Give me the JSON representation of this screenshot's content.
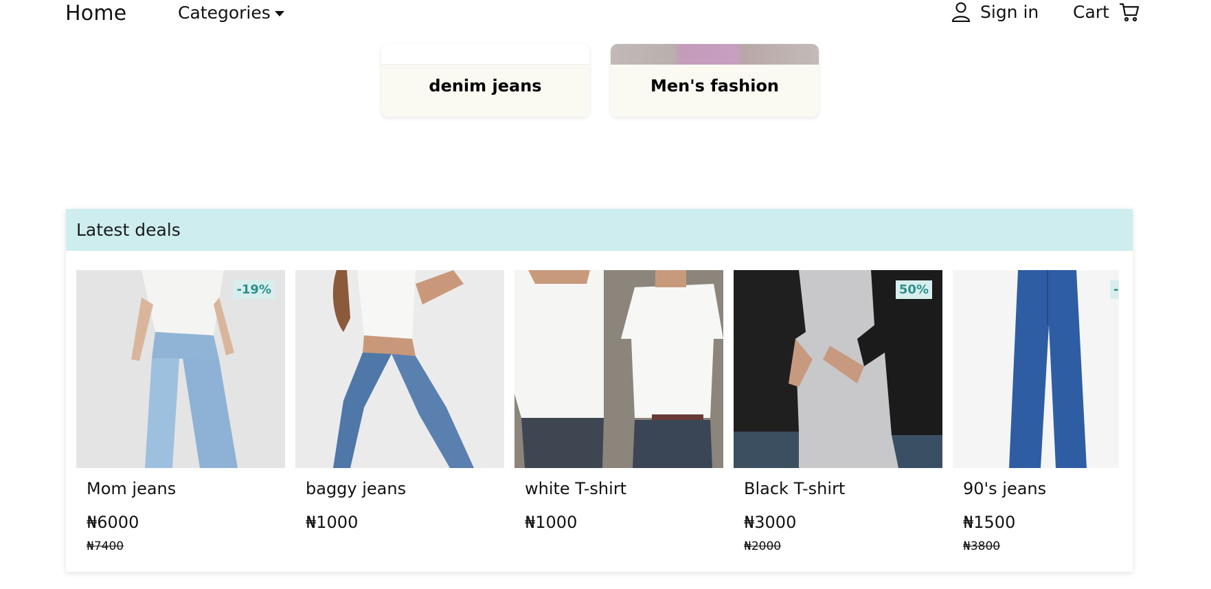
{
  "nav": {
    "home": "Home",
    "categories": "Categories",
    "sign_in": "Sign in",
    "cart": "Cart"
  },
  "categories": [
    {
      "label": "denim jeans"
    },
    {
      "label": "Men's fashion"
    }
  ],
  "deals": {
    "title": "Latest deals",
    "products": [
      {
        "name": "Mom jeans",
        "price": "₦6000",
        "old_price": "₦7400",
        "badge": "-19%"
      },
      {
        "name": "baggy jeans",
        "price": "₦1000",
        "old_price": "",
        "badge": ""
      },
      {
        "name": "white T-shirt",
        "price": "₦1000",
        "old_price": "",
        "badge": ""
      },
      {
        "name": "Black T-shirt",
        "price": "₦3000",
        "old_price": "₦2000",
        "badge": "50%"
      },
      {
        "name": "90's jeans",
        "price": "₦1500",
        "old_price": "₦3800",
        "badge": "-"
      }
    ]
  },
  "colors": {
    "deals_header_bg": "#cdedee",
    "badge_text": "#2c8f8a",
    "badge_bg": "#d8eeee",
    "category_card_bg": "#faf9f2"
  },
  "icons": [
    "user-icon",
    "cart-icon",
    "caret-down-icon"
  ]
}
